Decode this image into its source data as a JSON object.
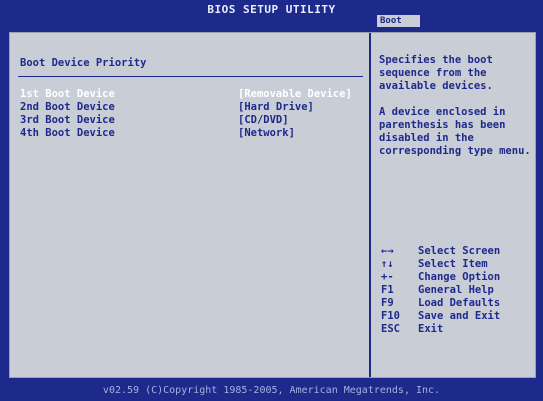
{
  "header": {
    "title": "BIOS SETUP UTILITY",
    "active_tab": "Boot"
  },
  "main": {
    "section_title": "Boot Device Priority",
    "boot_devices": [
      {
        "label": "1st Boot Device",
        "value": "[Removable Device]"
      },
      {
        "label": "2nd Boot Device",
        "value": "[Hard Drive]"
      },
      {
        "label": "3rd Boot Device",
        "value": "[CD/DVD]"
      },
      {
        "label": "4th Boot Device",
        "value": "[Network]"
      }
    ]
  },
  "help": {
    "text_1": "Specifies the boot sequence from the available devices.",
    "text_2": "A device enclosed in parenthesis has been disabled in the corresponding type menu.",
    "keys": [
      {
        "key": "←→",
        "desc": "Select Screen"
      },
      {
        "key": "↑↓",
        "desc": "Select Item"
      },
      {
        "key": "+-",
        "desc": "Change Option"
      },
      {
        "key": "F1",
        "desc": "General Help"
      },
      {
        "key": "F9",
        "desc": "Load Defaults"
      },
      {
        "key": "F10",
        "desc": "Save and Exit"
      },
      {
        "key": "ESC",
        "desc": "Exit"
      }
    ]
  },
  "footer": {
    "copyright": "v02.59 (C)Copyright 1985-2005, American Megatrends, Inc."
  },
  "colors": {
    "background": "#1d2a8c",
    "panel": "#c9cdd6",
    "text": "#1d2a8c",
    "selected_text": "#ffffff"
  }
}
